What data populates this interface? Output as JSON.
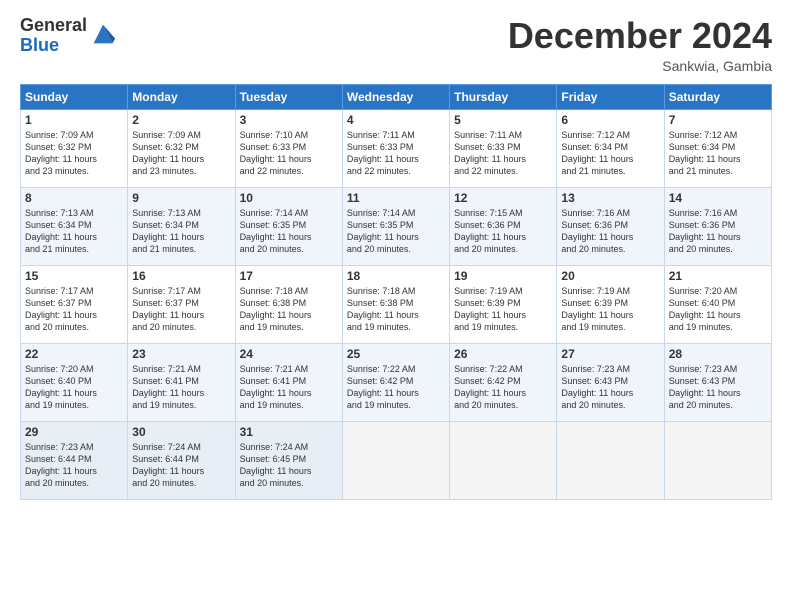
{
  "logo": {
    "general": "General",
    "blue": "Blue"
  },
  "title": {
    "month": "December 2024",
    "location": "Sankwia, Gambia"
  },
  "weekdays": [
    "Sunday",
    "Monday",
    "Tuesday",
    "Wednesday",
    "Thursday",
    "Friday",
    "Saturday"
  ],
  "weeks": [
    [
      {
        "day": "1",
        "sunrise": "7:09 AM",
        "sunset": "6:32 PM",
        "daylight": "11 hours and 23 minutes."
      },
      {
        "day": "2",
        "sunrise": "7:09 AM",
        "sunset": "6:32 PM",
        "daylight": "11 hours and 23 minutes."
      },
      {
        "day": "3",
        "sunrise": "7:10 AM",
        "sunset": "6:33 PM",
        "daylight": "11 hours and 22 minutes."
      },
      {
        "day": "4",
        "sunrise": "7:11 AM",
        "sunset": "6:33 PM",
        "daylight": "11 hours and 22 minutes."
      },
      {
        "day": "5",
        "sunrise": "7:11 AM",
        "sunset": "6:33 PM",
        "daylight": "11 hours and 22 minutes."
      },
      {
        "day": "6",
        "sunrise": "7:12 AM",
        "sunset": "6:34 PM",
        "daylight": "11 hours and 21 minutes."
      },
      {
        "day": "7",
        "sunrise": "7:12 AM",
        "sunset": "6:34 PM",
        "daylight": "11 hours and 21 minutes."
      }
    ],
    [
      {
        "day": "8",
        "sunrise": "7:13 AM",
        "sunset": "6:34 PM",
        "daylight": "11 hours and 21 minutes."
      },
      {
        "day": "9",
        "sunrise": "7:13 AM",
        "sunset": "6:34 PM",
        "daylight": "11 hours and 21 minutes."
      },
      {
        "day": "10",
        "sunrise": "7:14 AM",
        "sunset": "6:35 PM",
        "daylight": "11 hours and 20 minutes."
      },
      {
        "day": "11",
        "sunrise": "7:14 AM",
        "sunset": "6:35 PM",
        "daylight": "11 hours and 20 minutes."
      },
      {
        "day": "12",
        "sunrise": "7:15 AM",
        "sunset": "6:36 PM",
        "daylight": "11 hours and 20 minutes."
      },
      {
        "day": "13",
        "sunrise": "7:16 AM",
        "sunset": "6:36 PM",
        "daylight": "11 hours and 20 minutes."
      },
      {
        "day": "14",
        "sunrise": "7:16 AM",
        "sunset": "6:36 PM",
        "daylight": "11 hours and 20 minutes."
      }
    ],
    [
      {
        "day": "15",
        "sunrise": "7:17 AM",
        "sunset": "6:37 PM",
        "daylight": "11 hours and 20 minutes."
      },
      {
        "day": "16",
        "sunrise": "7:17 AM",
        "sunset": "6:37 PM",
        "daylight": "11 hours and 20 minutes."
      },
      {
        "day": "17",
        "sunrise": "7:18 AM",
        "sunset": "6:38 PM",
        "daylight": "11 hours and 19 minutes."
      },
      {
        "day": "18",
        "sunrise": "7:18 AM",
        "sunset": "6:38 PM",
        "daylight": "11 hours and 19 minutes."
      },
      {
        "day": "19",
        "sunrise": "7:19 AM",
        "sunset": "6:39 PM",
        "daylight": "11 hours and 19 minutes."
      },
      {
        "day": "20",
        "sunrise": "7:19 AM",
        "sunset": "6:39 PM",
        "daylight": "11 hours and 19 minutes."
      },
      {
        "day": "21",
        "sunrise": "7:20 AM",
        "sunset": "6:40 PM",
        "daylight": "11 hours and 19 minutes."
      }
    ],
    [
      {
        "day": "22",
        "sunrise": "7:20 AM",
        "sunset": "6:40 PM",
        "daylight": "11 hours and 19 minutes."
      },
      {
        "day": "23",
        "sunrise": "7:21 AM",
        "sunset": "6:41 PM",
        "daylight": "11 hours and 19 minutes."
      },
      {
        "day": "24",
        "sunrise": "7:21 AM",
        "sunset": "6:41 PM",
        "daylight": "11 hours and 19 minutes."
      },
      {
        "day": "25",
        "sunrise": "7:22 AM",
        "sunset": "6:42 PM",
        "daylight": "11 hours and 19 minutes."
      },
      {
        "day": "26",
        "sunrise": "7:22 AM",
        "sunset": "6:42 PM",
        "daylight": "11 hours and 20 minutes."
      },
      {
        "day": "27",
        "sunrise": "7:23 AM",
        "sunset": "6:43 PM",
        "daylight": "11 hours and 20 minutes."
      },
      {
        "day": "28",
        "sunrise": "7:23 AM",
        "sunset": "6:43 PM",
        "daylight": "11 hours and 20 minutes."
      }
    ],
    [
      {
        "day": "29",
        "sunrise": "7:23 AM",
        "sunset": "6:44 PM",
        "daylight": "11 hours and 20 minutes."
      },
      {
        "day": "30",
        "sunrise": "7:24 AM",
        "sunset": "6:44 PM",
        "daylight": "11 hours and 20 minutes."
      },
      {
        "day": "31",
        "sunrise": "7:24 AM",
        "sunset": "6:45 PM",
        "daylight": "11 hours and 20 minutes."
      },
      null,
      null,
      null,
      null
    ]
  ]
}
